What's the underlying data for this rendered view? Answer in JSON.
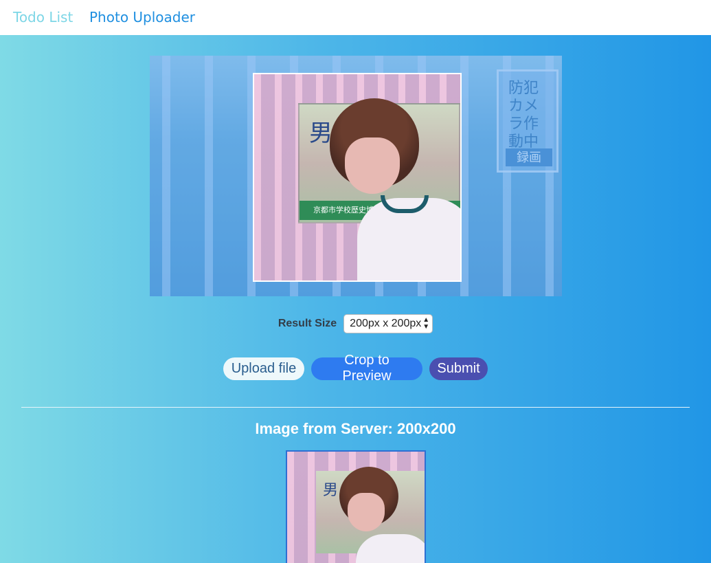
{
  "nav": {
    "items": [
      {
        "label": "Todo List",
        "active": false
      },
      {
        "label": "Photo Uploader",
        "active": true
      }
    ]
  },
  "cropper": {
    "photo_sign_text": "防犯カメラ作動中",
    "photo_sign_badge": "録画",
    "poster_title": "男",
    "poster_band_text": "京都市学校歴史博物館"
  },
  "controls": {
    "result_size_label": "Result Size",
    "result_size_selected": "200px x 200px",
    "upload_label": "Upload file",
    "crop_label": "Crop to Preview",
    "submit_label": "Submit"
  },
  "server": {
    "title": "Image from Server: 200x200"
  },
  "colors": {
    "gradient_start": "#7fdae6",
    "gradient_end": "#2196e6",
    "crop_button": "#2e7bf0",
    "submit_button": "#4a4fb0",
    "nav_active": "#1f8fe0",
    "nav_inactive": "#7dd6e6"
  }
}
